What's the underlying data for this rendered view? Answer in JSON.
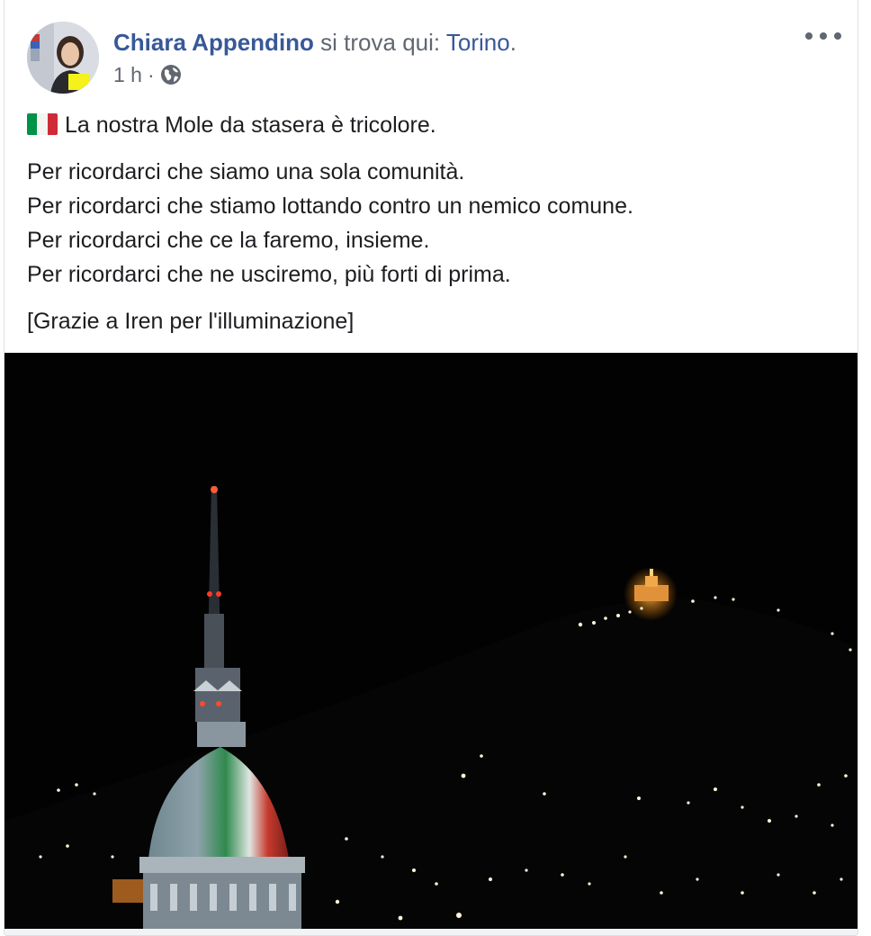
{
  "post": {
    "author": "Chiara Appendino",
    "location_prefix": "si trova qui: ",
    "location": "Torino",
    "location_suffix": ".",
    "time": "1 h",
    "separator": "·",
    "privacy_icon": "globe-icon",
    "more_icon": "more-horizontal-icon"
  },
  "text": {
    "flag_emoji": "italy-flag-icon",
    "line1": "La nostra Mole da stasera è tricolore.",
    "paragraph2": [
      "Per ricordarci che siamo una sola comunità.",
      "Per ricordarci che stiamo lottando contro un nemico comune.",
      "Per ricordarci che ce la faremo, insieme.",
      "Per ricordarci che ne usciremo, più forti di prima."
    ],
    "credit": "[Grazie a Iren per l'illuminazione]"
  },
  "colors": {
    "link": "#385898",
    "meta": "#616770",
    "text": "#1c1e21",
    "flag_green": "#009246",
    "flag_white": "#ffffff",
    "flag_red": "#ce2b37"
  },
  "photo": {
    "subject": "Mole Antonelliana lit in Italian tricolore at night, hillside with Superga basilica"
  }
}
